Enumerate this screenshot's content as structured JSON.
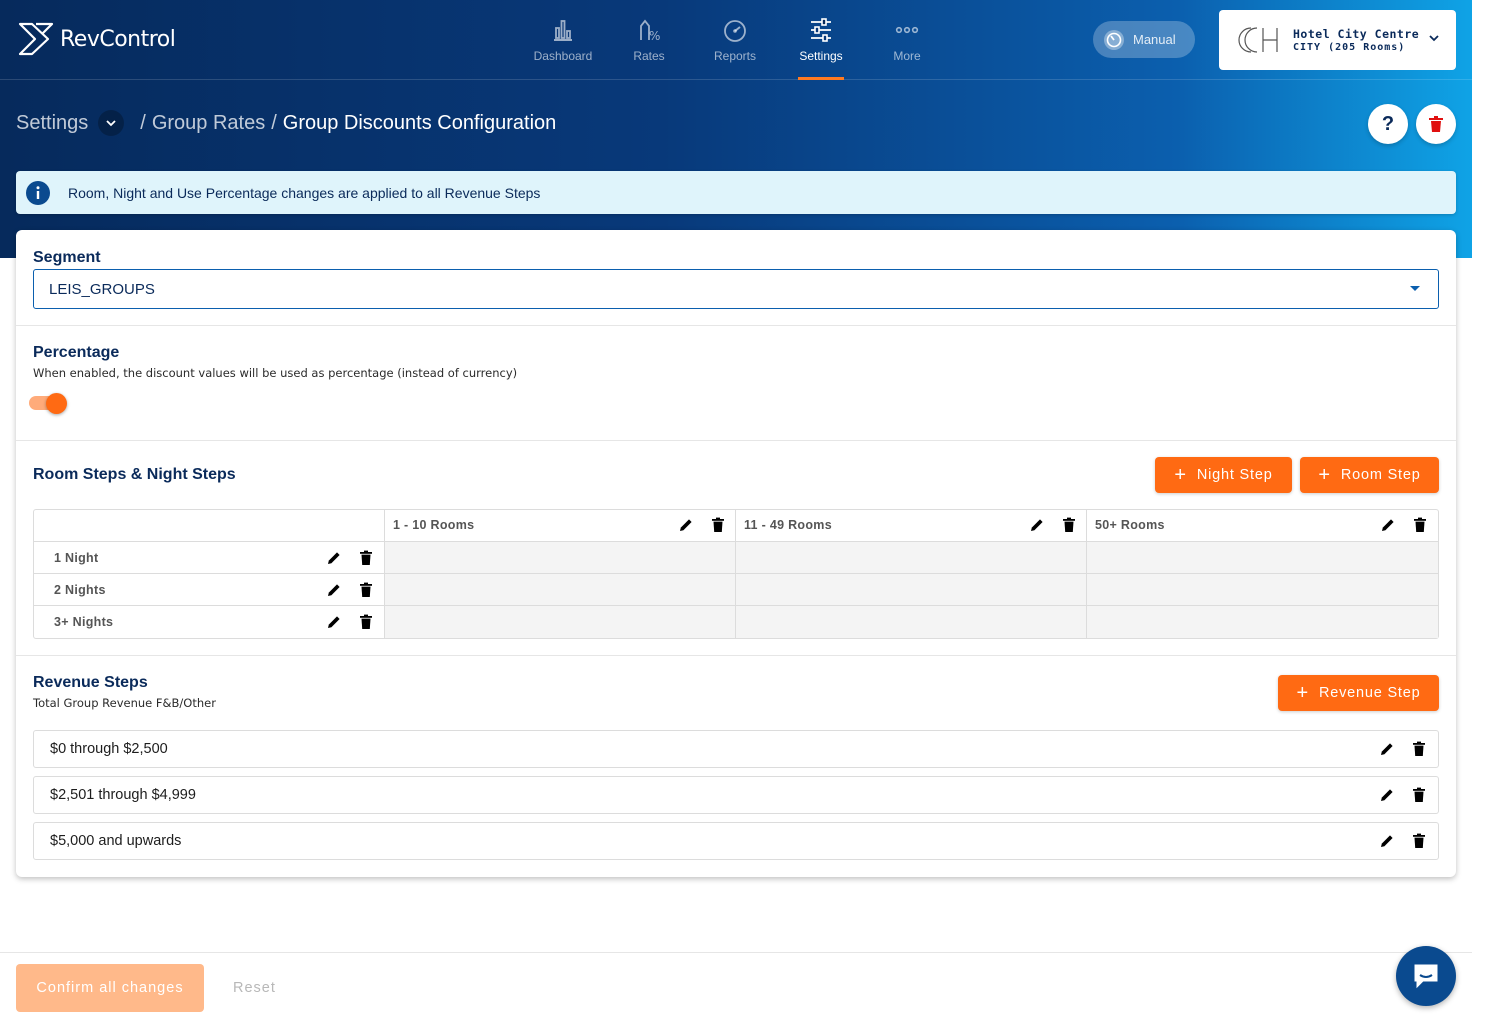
{
  "app": {
    "name": "RevControl"
  },
  "nav": {
    "items": [
      {
        "label": "Dashboard",
        "icon": "bar-chart-icon"
      },
      {
        "label": "Rates",
        "icon": "percent-rates-icon"
      },
      {
        "label": "Reports",
        "icon": "gauge-icon"
      },
      {
        "label": "Settings",
        "icon": "sliders-icon",
        "active": true
      },
      {
        "label": "More",
        "icon": "more-dots-icon"
      }
    ]
  },
  "mode_toggle": {
    "label": "Manual"
  },
  "hotel": {
    "name": "Hotel City Centre",
    "subtitle": "CITY (205 Rooms)"
  },
  "breadcrumb": {
    "root": "Settings",
    "parent": "Group Rates",
    "current": "Group Discounts Configuration",
    "separator": "/"
  },
  "header_actions": {
    "help_label": "?"
  },
  "info_banner": {
    "text": "Room, Night and Use Percentage changes are applied to all Revenue Steps"
  },
  "segment": {
    "label": "Segment",
    "value": "LEIS_GROUPS"
  },
  "percentage": {
    "title": "Percentage",
    "description": "When enabled, the discount values will be used as percentage (instead of currency)",
    "enabled": true
  },
  "steps": {
    "title": "Room Steps & Night Steps",
    "night_step_button": "Night Step",
    "room_step_button": "Room Step",
    "room_columns": [
      "1 - 10 Rooms",
      "11 - 49 Rooms",
      "50+ Rooms"
    ],
    "night_rows": [
      "1 Night",
      "2 Nights",
      "3+ Nights"
    ]
  },
  "revenue": {
    "title": "Revenue Steps",
    "subtitle": "Total Group Revenue F&B/Other",
    "add_button": "Revenue Step",
    "items": [
      "$0 through $2,500",
      "$2,501 through $4,999",
      "$5,000 and upwards"
    ]
  },
  "footer": {
    "confirm_label": "Confirm all changes",
    "reset_label": "Reset"
  },
  "colors": {
    "accent": "#ff6a13",
    "navy": "#0a2a5a",
    "info_bg": "#dff4fb",
    "delete_red": "#e01010"
  }
}
